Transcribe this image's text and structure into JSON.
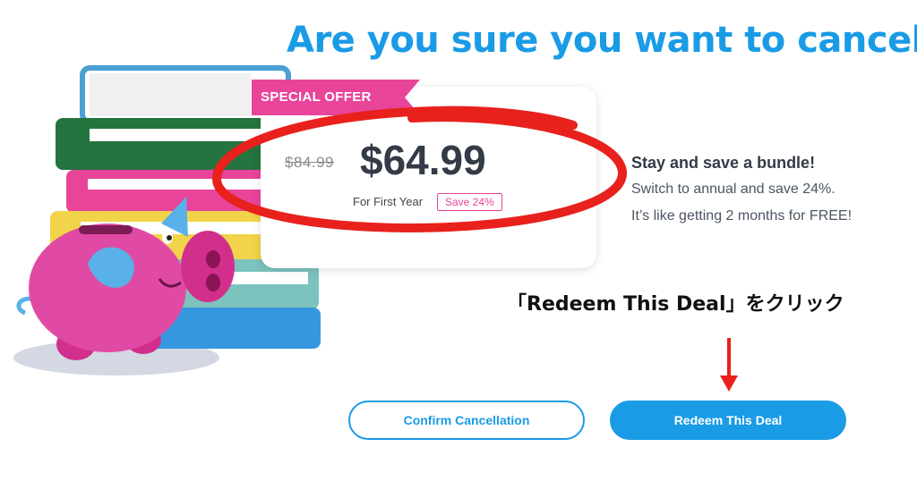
{
  "header": {
    "title": "Are you sure you want to cancel?"
  },
  "offer": {
    "ribbon_label": "SPECIAL OFFER",
    "old_price": "$84.99",
    "new_price": "$64.99",
    "term": "For First Year",
    "save_badge": "Save 24%"
  },
  "bundle": {
    "headline": "Stay and save a bundle!",
    "line1": "Switch to annual and save 24%.",
    "line2": "It’s like getting 2 months for FREE!"
  },
  "annotation": {
    "note": "「Redeem This Deal」をクリック"
  },
  "actions": {
    "confirm_label": "Confirm Cancellation",
    "redeem_label": "Redeem This Deal"
  },
  "colors": {
    "brand_blue": "#1a9be6",
    "pink": "#e8449a",
    "annotation_red": "#e8211d",
    "text_dark": "#333b47"
  },
  "icons": {
    "illustration": "piggy-bank-and-books-illustration",
    "annotation_circle": "red-hand-drawn-circle",
    "annotation_arrow": "red-down-arrow"
  }
}
